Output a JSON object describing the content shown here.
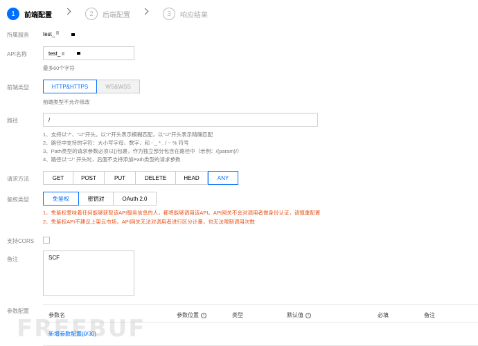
{
  "steps": [
    {
      "num": "1",
      "label": "前端配置"
    },
    {
      "num": "2",
      "label": "后端配置"
    },
    {
      "num": "3",
      "label": "响应结果"
    }
  ],
  "service": {
    "label": "所属服务",
    "value": "test_"
  },
  "api_name": {
    "label": "API名称",
    "value": "test_",
    "hint": "最多60个字符"
  },
  "frontend_type": {
    "label": "前端类型",
    "options": [
      "HTTP&HTTPS",
      "WS&WSS"
    ],
    "hint": "前端类型不允许修改"
  },
  "path": {
    "label": "路径",
    "value": "/",
    "hints": [
      "1、支持以\"/\"、\"=/\"开头。以\"/\"开头表示模糊匹配，以\"=/\"开头表示精确匹配",
      "2、路径中支持的字符：大小写字母、数字、和 - _ * . / ~ % 符号",
      "3、Path类型的请求参数必须以{}包裹，作为独立部分包含在路径中（示例：/{param}/）",
      "4、路径以\"=/\" 开头时，后面不支持添加Path类型的请求参数"
    ]
  },
  "method": {
    "label": "请求方法",
    "options": [
      "GET",
      "POST",
      "PUT",
      "DELETE",
      "HEAD",
      "ANY"
    ]
  },
  "auth": {
    "label": "鉴权类型",
    "options": [
      "免鉴权",
      "密钥对",
      "OAuth 2.0"
    ],
    "warnings": [
      "1、免鉴权意味着任何能够获取该API服务信息的人，都将能够调用该API。API网关不会对调用者做身份认证，请慎重配置",
      "2、免鉴权API不建议上架云市场，API网关无法对调用者进行区分计量，也无法限制调用次数"
    ]
  },
  "cors": {
    "label": "支持CORS"
  },
  "remark": {
    "label": "备注",
    "value": "SCF"
  },
  "params": {
    "label": "参数配置",
    "columns": [
      "参数名",
      "参数位置",
      "类型",
      "默认值",
      "必填",
      "备注"
    ],
    "add_link": "新增参数配置(0/30)"
  },
  "watermark": "FREEBUF"
}
